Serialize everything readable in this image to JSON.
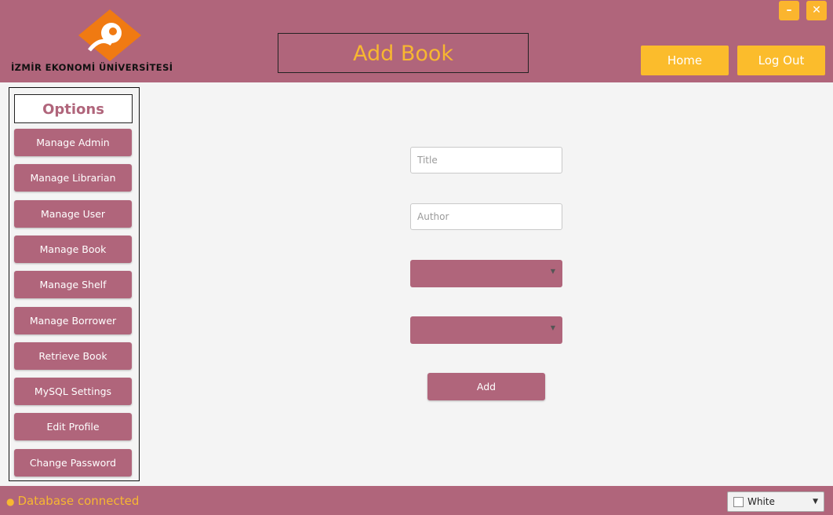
{
  "header": {
    "logo_text": "İZMİR EKONOMİ ÜNİVERSİTESİ",
    "page_title": "Add Book",
    "home_label": "Home",
    "logout_label": "Log Out",
    "minimize_glyph": "–",
    "close_glyph": "✕"
  },
  "sidebar": {
    "title": "Options",
    "items": [
      {
        "label": "Manage Admin"
      },
      {
        "label": "Manage Librarian"
      },
      {
        "label": "Manage User"
      },
      {
        "label": "Manage Book"
      },
      {
        "label": "Manage Shelf"
      },
      {
        "label": "Manage Borrower"
      },
      {
        "label": "Retrieve Book"
      },
      {
        "label": "MySQL Settings"
      },
      {
        "label": "Edit Profile"
      },
      {
        "label": "Change Password"
      }
    ]
  },
  "form": {
    "title_placeholder": "Title",
    "author_placeholder": "Author",
    "add_label": "Add"
  },
  "statusbar": {
    "status_text": "Database connected",
    "theme_value": "White"
  },
  "icons": {
    "logo": "university-logo-icon",
    "status": "status-dot-icon",
    "combo_arrow": "chevron-down-icon"
  },
  "colors": {
    "primary": "#b0657b",
    "accent": "#fbbc2c",
    "title_text": "#f7b731",
    "background": "#f4f4f4"
  }
}
